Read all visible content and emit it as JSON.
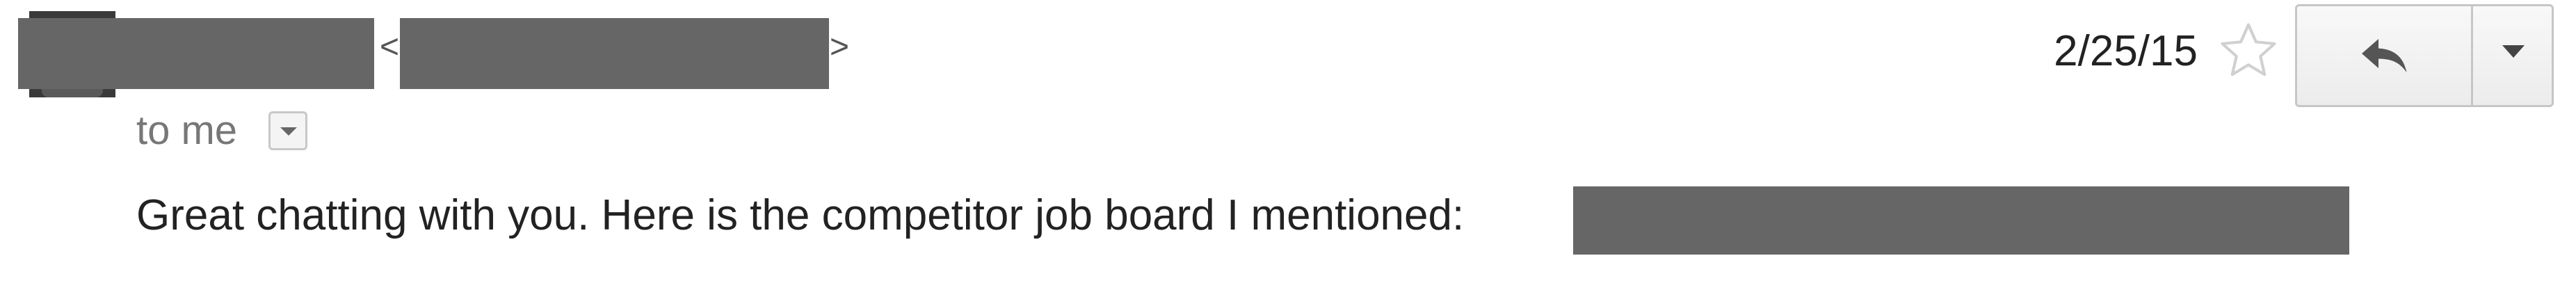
{
  "message": {
    "recipient_text": "to me",
    "angle_open": "<",
    "angle_close": ">",
    "date": "2/25/15",
    "body_text": "Great chatting with you. Here is the competitor job board I mentioned:"
  },
  "icons": {
    "avatar": "avatar",
    "details_toggle": "chevron-down-icon",
    "star": "star-outline-icon",
    "reply": "reply-arrow-icon",
    "more": "caret-down-icon"
  },
  "colors": {
    "redaction": "#666666",
    "muted_text": "#777777",
    "text": "#222222",
    "star_outline": "#d0d0d0"
  }
}
